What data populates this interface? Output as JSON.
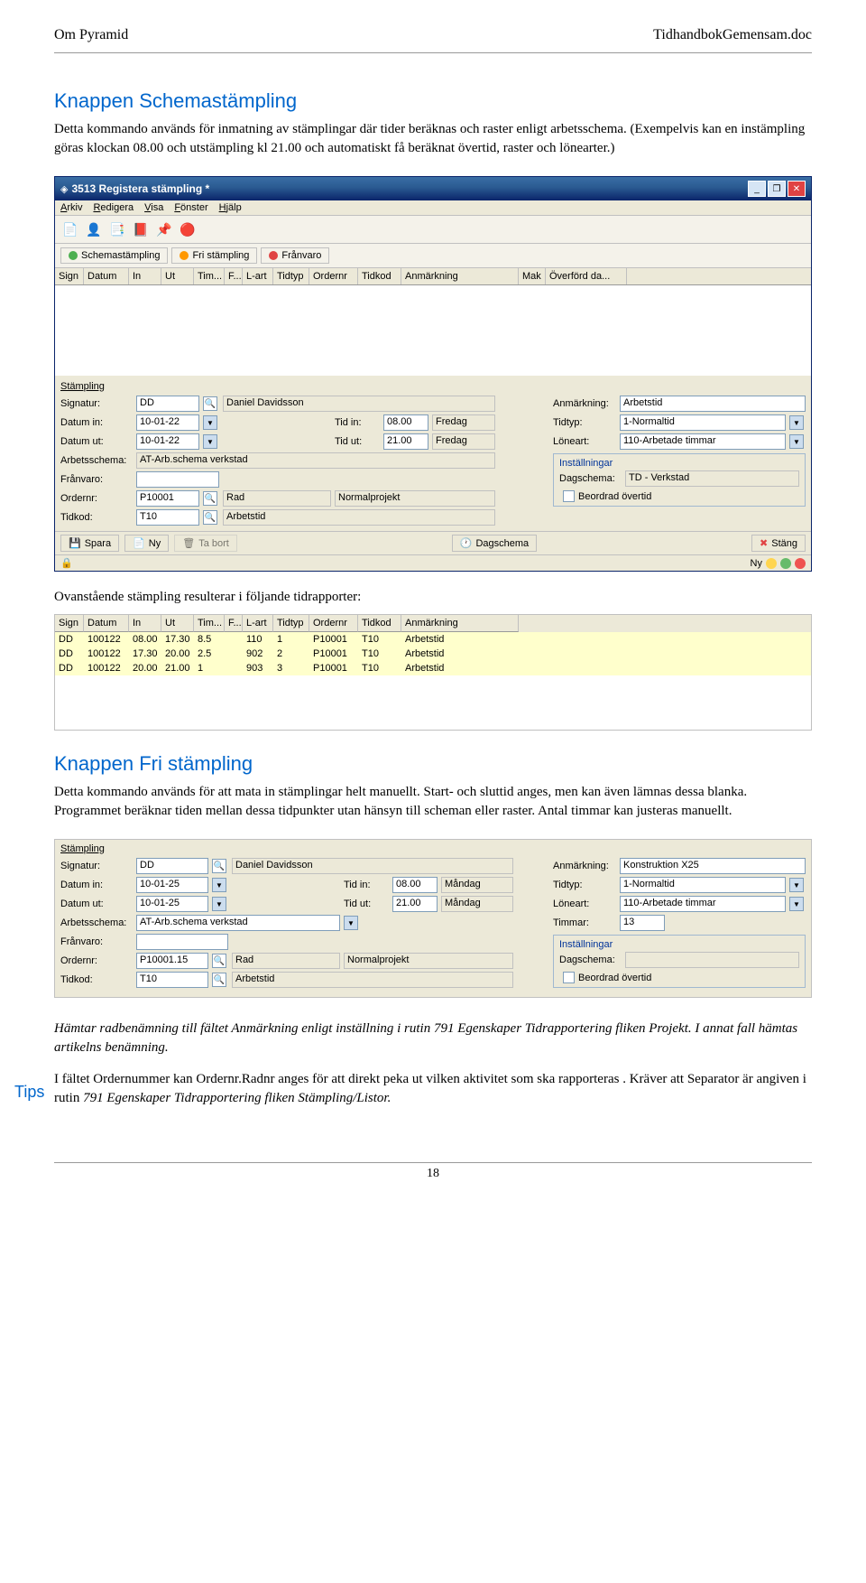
{
  "header": {
    "left": "Om Pyramid",
    "right": "TidhandbokGemensam.doc"
  },
  "section1": {
    "title": "Knappen Schemastämpling",
    "text": "Detta kommando används för inmatning av stämplingar där tider beräknas och raster enligt arbetsschema. (Exempelvis kan en instämpling göras klockan 08.00 och utstämpling kl 21.00 och automatiskt få beräknat övertid, raster och lönearter.)"
  },
  "window": {
    "title": "3513 Registera stämpling *",
    "menu": [
      "Arkiv",
      "Redigera",
      "Visa",
      "Fönster",
      "Hjälp"
    ],
    "toolIcons": [
      "📄",
      "👤",
      "📑",
      "📕",
      "📌",
      "🔴"
    ],
    "buttons": [
      {
        "label": "Schemastämpling",
        "dot": "green"
      },
      {
        "label": "Fri stämpling",
        "dot": "orange"
      },
      {
        "label": "Frånvaro",
        "dot": "red"
      }
    ],
    "gridCols": [
      "Sign",
      "Datum",
      "In",
      "Ut",
      "Tim...",
      "F...",
      "L-art",
      "Tidtyp",
      "Ordernr",
      "Tidkod",
      "Anmärkning",
      "Mak",
      "Överförd da..."
    ],
    "form": {
      "legend": "Stämpling",
      "signatur_lbl": "Signatur:",
      "signatur": "DD",
      "signatur_name": "Daniel Davidsson",
      "anm_lbl": "Anmärkning:",
      "anm": "Arbetstid",
      "din_lbl": "Datum in:",
      "din": "10-01-22",
      "tin_lbl": "Tid in:",
      "tin": "08.00",
      "day": "Fredag",
      "tidtyp_lbl": "Tidtyp:",
      "tidtyp": "1-Normaltid",
      "dut_lbl": "Datum ut:",
      "dut": "10-01-22",
      "tut_lbl": "Tid ut:",
      "tut": "21.00",
      "loneart_lbl": "Löneart:",
      "loneart": "110-Arbetade timmar",
      "arb_lbl": "Arbetsschema:",
      "arb": "AT-Arb.schema verkstad",
      "franv_lbl": "Frånvaro:",
      "ord_lbl": "Ordernr:",
      "ord": "P10001",
      "ord_name": "Rad",
      "ord_proj": "Normalprojekt",
      "tk_lbl": "Tidkod:",
      "tk": "T10",
      "tk_name": "Arbetstid",
      "inst_legend": "Inställningar",
      "dag_lbl": "Dagschema:",
      "dag": "TD - Verkstad",
      "beordrad": "Beordrad övertid"
    },
    "footerBtns": {
      "spara": "Spara",
      "ny": "Ny",
      "tabort": "Ta bort",
      "dagschema": "Dagschema",
      "stang": "Stäng"
    },
    "status": {
      "left": "",
      "right": "Ny"
    }
  },
  "reportIntro": "Ovanstående stämpling resulterar i följande tidrapporter:",
  "report": {
    "cols": [
      "Sign",
      "Datum",
      "In",
      "Ut",
      "Tim...",
      "F...",
      "L-art",
      "Tidtyp",
      "Ordernr",
      "Tidkod",
      "Anmärkning"
    ],
    "rows": [
      [
        "DD",
        "100122",
        "08.00",
        "17.30",
        "8.5",
        "",
        "110",
        "1",
        "P10001",
        "T10",
        "Arbetstid"
      ],
      [
        "DD",
        "100122",
        "17.30",
        "20.00",
        "2.5",
        "",
        "902",
        "2",
        "P10001",
        "T10",
        "Arbetstid"
      ],
      [
        "DD",
        "100122",
        "20.00",
        "21.00",
        "1",
        "",
        "903",
        "3",
        "P10001",
        "T10",
        "Arbetstid"
      ]
    ]
  },
  "section2": {
    "title": "Knappen Fri stämpling",
    "text": "Detta kommando används för att mata in stämplingar helt manuellt. Start- och sluttid anges, men kan även lämnas dessa blanka. Programmet beräknar tiden mellan dessa tidpunkter utan hänsyn till scheman eller raster. Antal timmar kan justeras manuellt."
  },
  "panel2": {
    "legend": "Stämpling",
    "signatur_lbl": "Signatur:",
    "signatur": "DD",
    "signatur_name": "Daniel Davidsson",
    "anm_lbl": "Anmärkning:",
    "anm": "Konstruktion X25",
    "din_lbl": "Datum in:",
    "din": "10-01-25",
    "tin_lbl": "Tid in:",
    "tin": "08.00",
    "day": "Måndag",
    "tidtyp_lbl": "Tidtyp:",
    "tidtyp": "1-Normaltid",
    "dut_lbl": "Datum ut:",
    "dut": "10-01-25",
    "tut_lbl": "Tid ut:",
    "tut": "21.00",
    "loneart_lbl": "Löneart:",
    "loneart": "110-Arbetade timmar",
    "arb_lbl": "Arbetsschema:",
    "arb": "AT-Arb.schema verkstad",
    "tim_lbl": "Timmar:",
    "tim": "13",
    "franv_lbl": "Frånvaro:",
    "ord_lbl": "Ordernr:",
    "ord": "P10001.15",
    "ord_name": "Rad",
    "ord_proj": "Normalprojekt",
    "tk_lbl": "Tidkod:",
    "tk": "T10",
    "tk_name": "Arbetstid",
    "inst_legend": "Inställningar",
    "dag_lbl": "Dagschema:",
    "beordrad": "Beordrad övertid"
  },
  "note1": "Hämtar radbenämning till fältet Anmärkning enligt inställning i rutin 791 Egenskaper Tidrapportering fliken Projekt. I annat fall hämtas artikelns benämning.",
  "tips_label": "Tips",
  "tips_text1": "I fältet Ordernummer kan Ordernr.Radnr anges för att direkt peka ut vilken aktivitet som ska rapporteras . Kräver att Separator är angiven i rutin ",
  "tips_text2": "791 Egenskaper Tidrapportering fliken Stämpling/Listor.",
  "pageno": "18"
}
